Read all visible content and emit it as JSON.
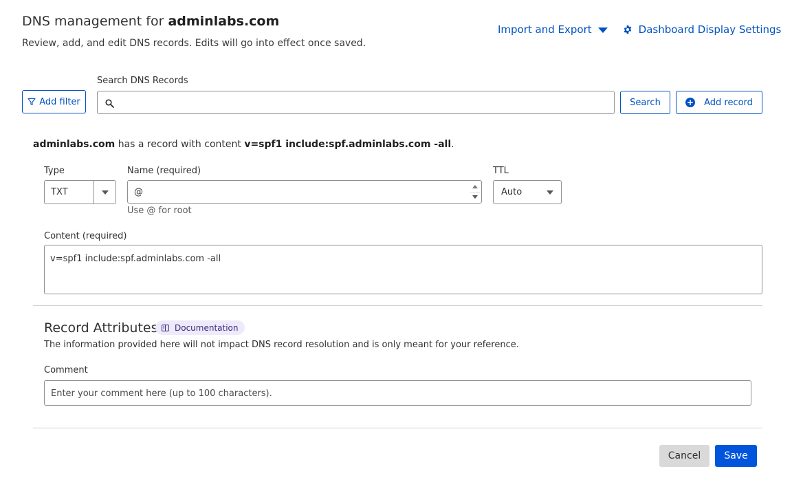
{
  "header": {
    "title_prefix": "DNS management for",
    "domain": "adminlabs.com",
    "subtitle": "Review, add, and edit DNS records. Edits will go into effect once saved.",
    "import_export_label": "Import and Export",
    "dashboard_settings_label": "Dashboard Display Settings"
  },
  "toolbar": {
    "add_filter_label": "Add filter",
    "search_label": "Search DNS Records",
    "search_value": "",
    "search_button_label": "Search",
    "add_record_label": "Add record"
  },
  "record": {
    "sentence_domain": "adminlabs.com",
    "sentence_middle": "has a record with content",
    "sentence_content": "v=spf1 include:spf.adminlabs.com -all",
    "sentence_end": ".",
    "type_label": "Type",
    "type_value": "TXT",
    "name_label": "Name (required)",
    "name_value": "@",
    "name_hint": "Use @ for root",
    "ttl_label": "TTL",
    "ttl_value": "Auto",
    "content_label": "Content (required)",
    "content_value": "v=spf1 include:spf.adminlabs.com -all"
  },
  "attributes": {
    "title": "Record Attributes",
    "doc_label": "Documentation",
    "description": "The information provided here will not impact DNS record resolution and is only meant for your reference.",
    "comment_label": "Comment",
    "comment_placeholder": "Enter your comment here (up to 100 characters)."
  },
  "actions": {
    "cancel_label": "Cancel",
    "save_label": "Save"
  },
  "colors": {
    "link": "#0051c3",
    "primary": "#0055dc",
    "badge_bg": "#eeeafa"
  }
}
